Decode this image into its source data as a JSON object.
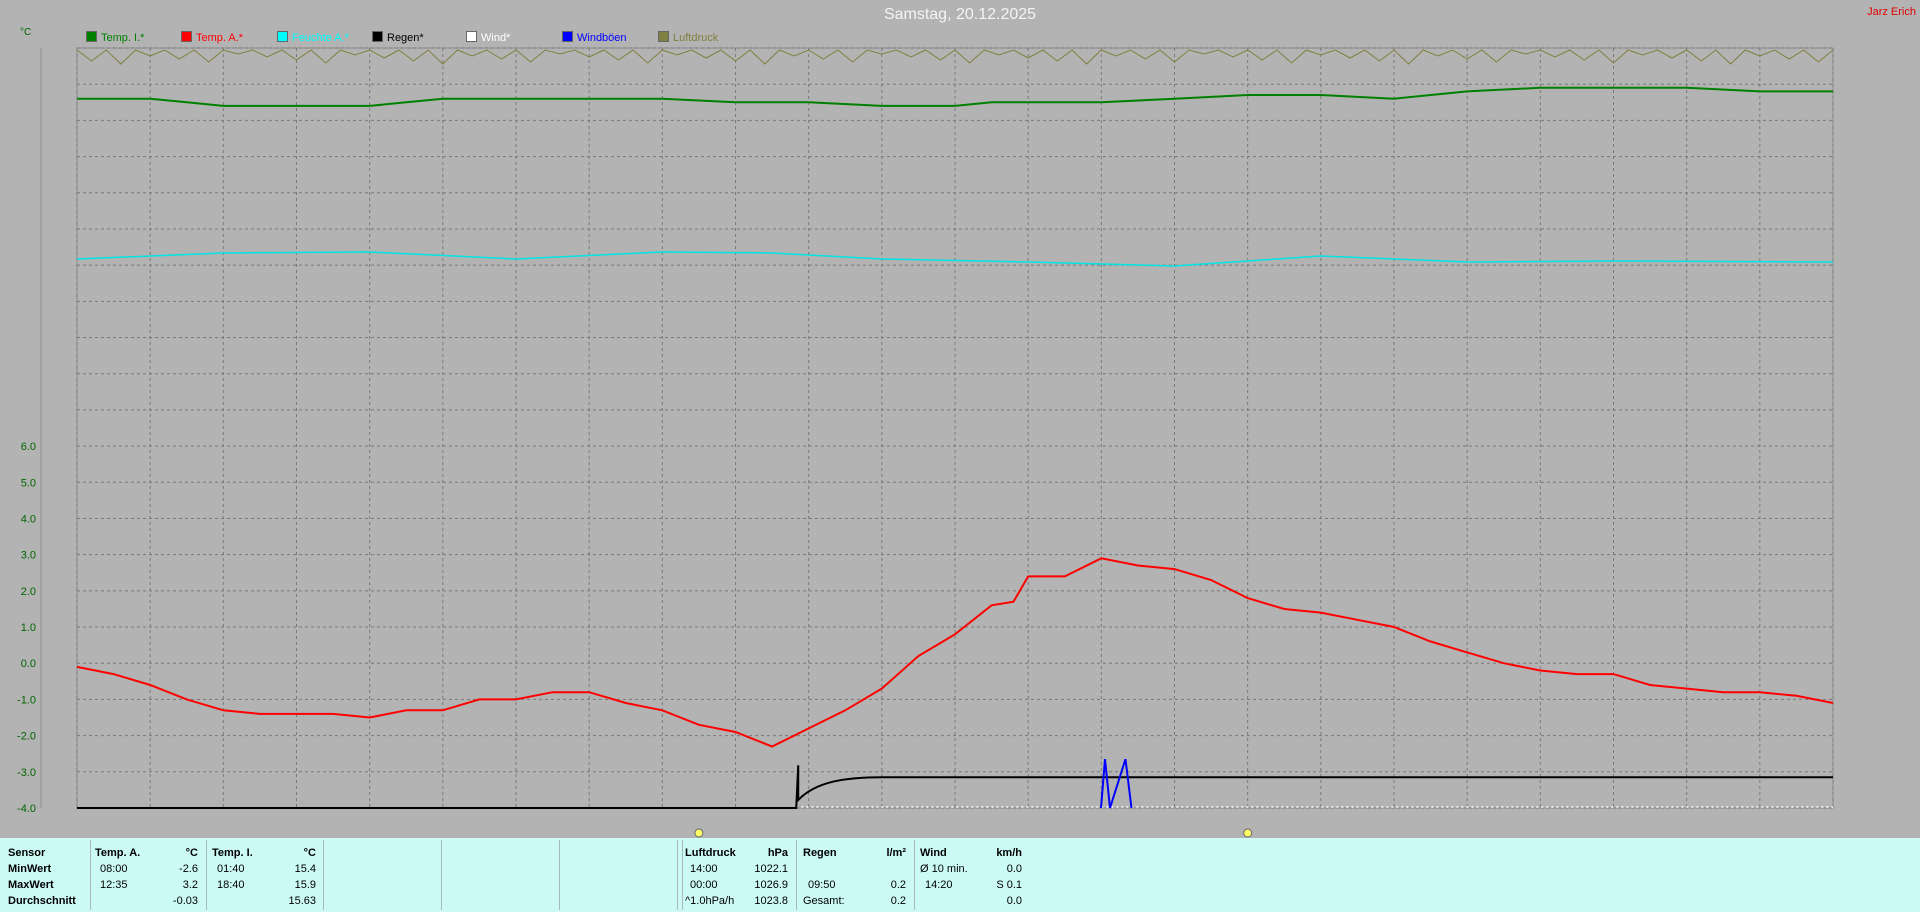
{
  "header": {
    "title": "Samstag, 20.12.2025",
    "author": "Jarz Erich",
    "unit": "°C"
  },
  "legend": [
    {
      "label": "Temp. I.*",
      "color": "#008000"
    },
    {
      "label": "Temp. A.*",
      "color": "#ff0000"
    },
    {
      "label": "Feuchte A.*",
      "color": "#00ffff"
    },
    {
      "label": "Regen*",
      "color": "#000000"
    },
    {
      "label": "Wind*",
      "color": "#ffffff"
    },
    {
      "label": "Windböen",
      "color": "#0000ff"
    },
    {
      "label": "Luftdruck",
      "color": "#808040"
    }
  ],
  "chart_data": {
    "type": "line",
    "x_unit": "hour",
    "xlim": [
      0,
      24
    ],
    "ylim": [
      -4.0,
      17.0
    ],
    "y_ticks": [
      6.0,
      5.0,
      4.0,
      3.0,
      2.0,
      1.0,
      0.0,
      -1.0,
      -2.0,
      -3.0,
      -4.0
    ],
    "y_tick_labels": [
      "6.0",
      "5.0",
      "4.0",
      "3.0",
      "2.0",
      "1.0",
      "0.0",
      "-1.0",
      "-2.0",
      "-3.0",
      "-4.0"
    ],
    "grid": true,
    "series": [
      {
        "name": "Temp. A.*",
        "color": "#ff0000",
        "x": [
          0,
          0.5,
          1,
          1.5,
          2,
          2.5,
          3,
          3.5,
          4,
          4.5,
          5,
          5.5,
          6,
          6.5,
          7,
          7.5,
          8,
          8.5,
          9,
          9.5,
          10,
          10.5,
          11,
          11.5,
          12,
          12.5,
          12.8,
          13,
          13.5,
          14,
          14.5,
          15,
          15.5,
          16,
          16.5,
          17,
          17.5,
          18,
          18.5,
          19,
          19.5,
          20,
          20.5,
          21,
          21.5,
          22,
          22.5,
          23,
          23.5,
          24
        ],
        "y": [
          -0.1,
          -0.3,
          -0.6,
          -1.0,
          -1.3,
          -1.4,
          -1.4,
          -1.4,
          -1.5,
          -1.3,
          -1.3,
          -1.0,
          -1.0,
          -0.8,
          -0.8,
          -1.1,
          -1.3,
          -1.7,
          -1.9,
          -2.3,
          -1.8,
          -1.3,
          -0.7,
          0.2,
          0.8,
          1.6,
          1.7,
          2.4,
          2.4,
          2.9,
          2.7,
          2.6,
          2.3,
          1.8,
          1.5,
          1.4,
          1.2,
          1.0,
          0.6,
          0.3,
          0.0,
          -0.2,
          -0.3,
          -0.3,
          -0.6,
          -0.7,
          -0.8,
          -0.8,
          -0.9,
          -1.1
        ]
      },
      {
        "name": "Temp. I.*",
        "color": "#008000",
        "x": [
          0,
          1,
          1.5,
          2,
          2.5,
          3,
          3.5,
          4,
          4.5,
          5,
          6,
          7,
          8,
          9,
          10,
          11,
          11.5,
          12,
          12.5,
          13,
          14,
          15,
          16,
          17,
          18,
          19,
          20,
          21,
          22,
          23,
          24
        ],
        "y": [
          15.6,
          15.6,
          15.5,
          15.4,
          15.4,
          15.4,
          15.4,
          15.4,
          15.5,
          15.6,
          15.6,
          15.6,
          15.6,
          15.5,
          15.5,
          15.4,
          15.4,
          15.4,
          15.5,
          15.5,
          15.5,
          15.6,
          15.7,
          15.7,
          15.6,
          15.8,
          15.9,
          15.9,
          15.9,
          15.8,
          15.8
        ]
      },
      {
        "name": "Feuchte A.*",
        "color": "#00ffff",
        "values": "curve without printed axis"
      },
      {
        "name": "Regen*",
        "color": "#000000",
        "totals_l_m2": 0.2,
        "start_time": "09:50"
      },
      {
        "name": "Windböen",
        "color": "#0000ff",
        "max_kmh": 0.1,
        "max_time": "14:20"
      }
    ]
  },
  "stats": {
    "row_headers": [
      "Sensor",
      "MinWert",
      "MaxWert",
      "Durchschnitt"
    ],
    "temp_a": {
      "title": "Temp. A.",
      "unit": "°C",
      "min_time": "08:00",
      "min_val": "-2.6",
      "max_time": "12:35",
      "max_val": "3.2",
      "avg": "-0.03"
    },
    "temp_i": {
      "title": "Temp. I.",
      "unit": "°C",
      "min_time": "01:40",
      "min_val": "15.4",
      "max_time": "18:40",
      "max_val": "15.9",
      "avg": "15.63"
    },
    "pressure": {
      "title": "Luftdruck",
      "unit": "hPa",
      "min_time": "14:00",
      "min_val": "1022.1",
      "max_time": "00:00",
      "max_val": "1026.9",
      "trend_label": "^1.0hPa/h",
      "trend_val": "1023.8"
    },
    "rain": {
      "title": "Regen",
      "unit": "l/m²",
      "time": "09:50",
      "val": "0.2",
      "total_label": "Gesamt:",
      "total_val": "0.2"
    },
    "wind": {
      "title": "Wind",
      "unit": "km/h",
      "avg_label": "Ø 10 min.",
      "avg_val": "0.0",
      "max_time": "14:20",
      "max_val": "S 0.1",
      "last_val": "0.0"
    }
  }
}
